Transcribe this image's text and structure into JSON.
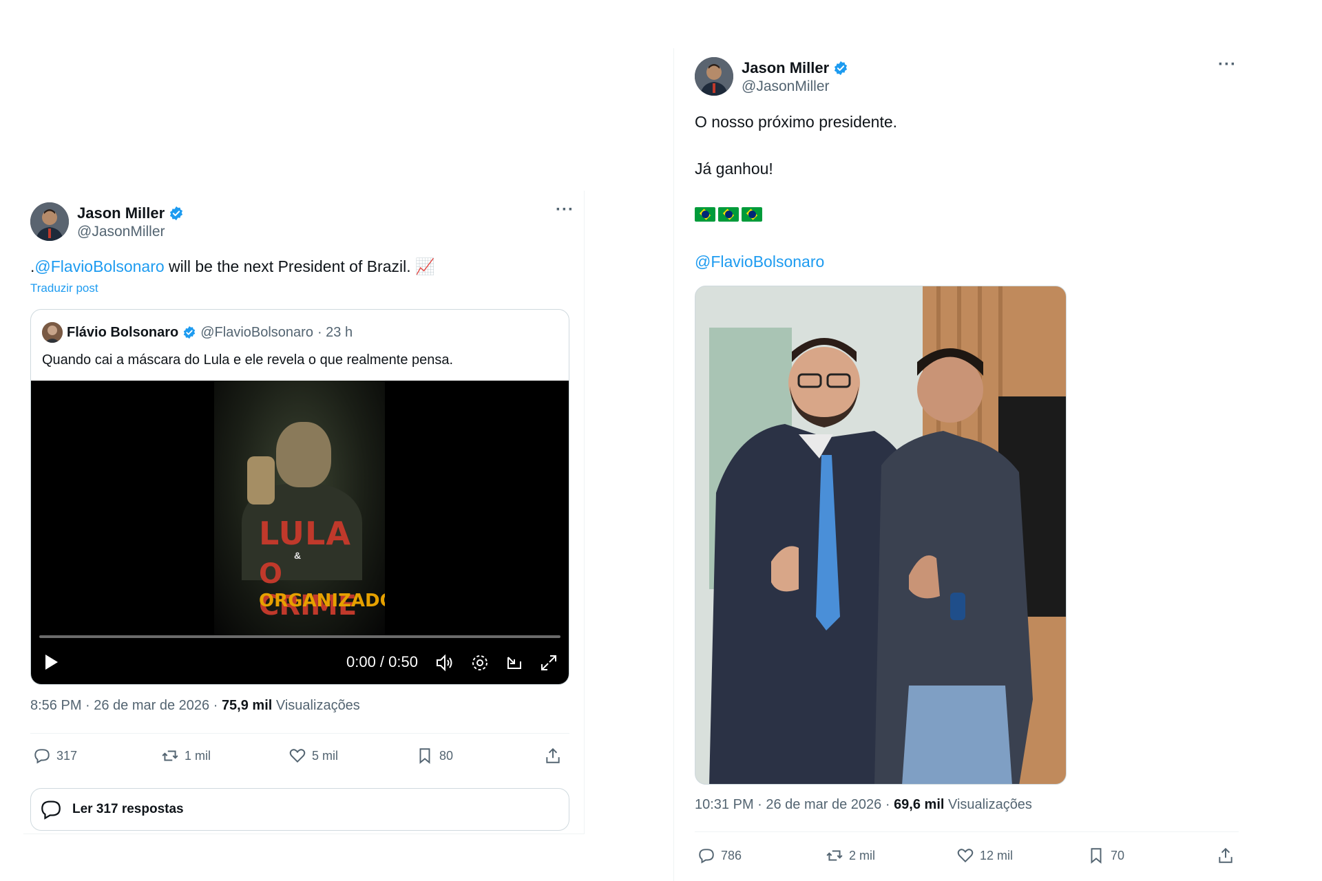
{
  "post_left": {
    "author_name": "Jason Miller",
    "author_handle": "@JasonMiller",
    "more_label": "···",
    "text_prefix": ".",
    "text_mention": "@FlavioBolsonaro",
    "text_body": " will be the next President of Brazil.",
    "text_emoji": "📈",
    "translate_label": "Traduzir post",
    "quote": {
      "author_name": "Flávio Bolsonaro",
      "author_handle": "@FlavioBolsonaro",
      "age": "· 23 h",
      "text": "Quando cai a máscara do Lula e ele revela o que realmente pensa.",
      "video": {
        "time": "0:00 / 0:50",
        "poster_line1": "LULA",
        "poster_line2": "&",
        "poster_line3": "O CRIME",
        "poster_line4": "ORGANIZADO"
      }
    },
    "timestamp": "8:56 PM · 26 de mar de 2026 · ",
    "views_count": "75,9 mil",
    "views_label": " Visualizações",
    "actions": {
      "replies": "317",
      "reposts": "1 mil",
      "likes": "5 mil",
      "bookmarks": "80"
    },
    "read_replies_label": "Ler 317 respostas"
  },
  "post_right": {
    "author_name": "Jason Miller",
    "author_handle": "@JasonMiller",
    "more_label": "···",
    "line1": "O nosso próximo presidente.",
    "line2": "Já ganhou!",
    "flags": [
      "brazil-flag-icon",
      "brazil-flag-icon",
      "brazil-flag-icon"
    ],
    "mention": "@FlavioBolsonaro",
    "timestamp": "10:31 PM · 26 de mar de 2026 · ",
    "views_count": "69,6 mil",
    "views_label": " Visualizações",
    "actions": {
      "replies": "786",
      "reposts": "2 mil",
      "likes": "12 mil",
      "bookmarks": "70"
    }
  },
  "colors": {
    "accent": "#1d9bf0",
    "muted": "#536471",
    "text": "#0f1419",
    "border": "#cfd9de"
  }
}
